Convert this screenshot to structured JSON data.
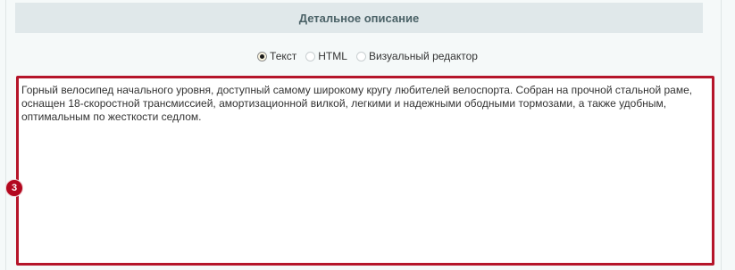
{
  "section": {
    "title": "Детальное описание"
  },
  "format_options": [
    {
      "label": "Текст",
      "selected": true
    },
    {
      "label": "HTML",
      "selected": false
    },
    {
      "label": "Визуальный редактор",
      "selected": false
    }
  ],
  "description": {
    "value": "Горный велосипед начального уровня, доступный самому широкому кругу любителей велоспорта. Собран на прочной стальной раме, оснащен 18-скоростной трансмиссией, амортизационной вилкой, легкими и надежными ободными тормозами, а также удобным, оптимальным по жесткости седлом."
  },
  "step_badge": {
    "label": "3"
  },
  "colors": {
    "highlight": "#b5152a",
    "badge": "#b3081f",
    "header_bg": "#e0e8ea"
  }
}
